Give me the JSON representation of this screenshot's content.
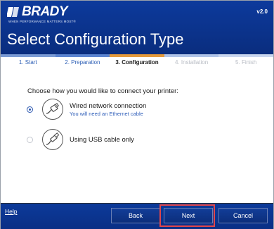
{
  "header": {
    "logo_text": "BRADY",
    "tagline": "WHEN PERFORMANCE MATTERS MOST®",
    "version": "v2.0",
    "title": "Select Configuration Type"
  },
  "steps": [
    {
      "label": "1. Start",
      "state": "done"
    },
    {
      "label": "2. Preparation",
      "state": "done"
    },
    {
      "label": "3. Configuration",
      "state": "active"
    },
    {
      "label": "4. Installation",
      "state": "future"
    },
    {
      "label": "5. Finish",
      "state": "future"
    }
  ],
  "colors": {
    "header_blue": "#0b338c",
    "stripe_1": "#7b9bd4",
    "stripe_2": "#5c84d0",
    "stripe_3": "#e59a3b",
    "stripe_4": "#b0c4e8",
    "stripe_5": "#c9d6ee",
    "link_blue": "#2c5cb8",
    "highlight_red": "#e0464a"
  },
  "content": {
    "prompt": "Choose how you would like to connect your printer:",
    "options": [
      {
        "label": "Wired network connection",
        "sublabel": "You will need an Ethernet cable",
        "selected": true,
        "icon": "ethernet-cable-icon"
      },
      {
        "label": "Using USB cable only",
        "sublabel": "",
        "selected": false,
        "icon": "usb-cable-icon"
      }
    ]
  },
  "footer": {
    "help": "Help",
    "back": "Back",
    "next": "Next",
    "cancel": "Cancel"
  }
}
